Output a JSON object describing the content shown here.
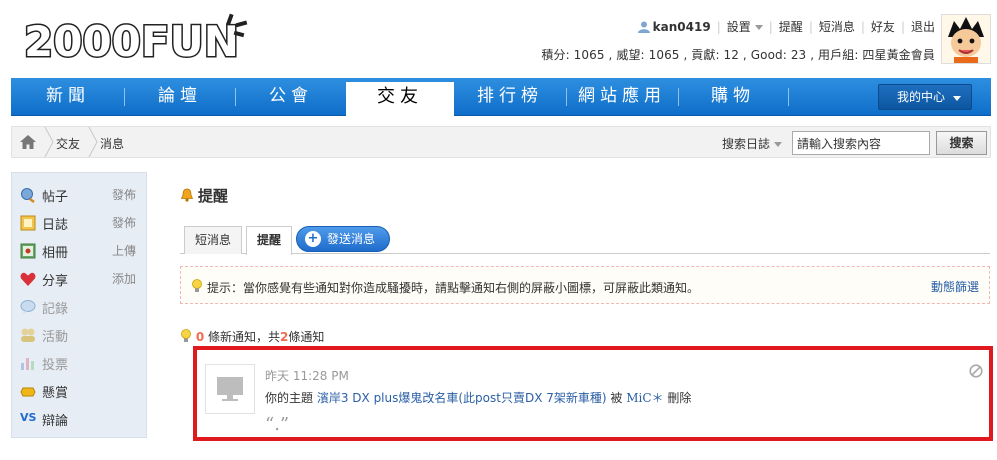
{
  "header": {
    "logo_text": "2000FUN",
    "username": "kan0419",
    "menu": [
      "設置",
      "提醒",
      "短消息",
      "好友",
      "退出"
    ],
    "stats": "積分: 1065 , 威望: 1065 , 貢獻: 12 , Good: 23 , 用戶組: 四星黃金會員"
  },
  "nav": {
    "items": [
      "新聞",
      "論壇",
      "公會",
      "交友",
      "排行榜",
      "網站應用",
      "購物"
    ],
    "my_center": "我的中心"
  },
  "breadcrumb": {
    "items": [
      "交友",
      "消息"
    ],
    "search_label": "搜索日誌",
    "search_placeholder": "請輸入搜索內容",
    "search_button": "搜索"
  },
  "sidebar": {
    "items": [
      {
        "label": "帖子",
        "action": "發佈",
        "icon": "post-icon"
      },
      {
        "label": "日誌",
        "action": "發佈",
        "icon": "blog-icon"
      },
      {
        "label": "相冊",
        "action": "上傳",
        "icon": "album-icon"
      },
      {
        "label": "分享",
        "action": "添加",
        "icon": "share-icon"
      },
      {
        "label": "記錄",
        "action": "",
        "icon": "record-icon"
      },
      {
        "label": "活動",
        "action": "",
        "icon": "activity-icon"
      },
      {
        "label": "投票",
        "action": "",
        "icon": "poll-icon"
      },
      {
        "label": "懸賞",
        "action": "",
        "icon": "reward-icon"
      },
      {
        "label": "辯論",
        "action": "",
        "icon": "debate-icon",
        "prefix": "VS"
      }
    ]
  },
  "main": {
    "title": "提醒",
    "tabs": [
      "短消息",
      "提醒"
    ],
    "compose": "發送消息",
    "tip": "提示：當你感覺有些通知對你造成騷擾時，請點擊通知右側的屏蔽小圖標，可屏蔽此類通知。",
    "tip_link": "動態篩選",
    "count_new": "0",
    "count_new_label": "條新通知，共",
    "count_total": "2",
    "count_total_label": "條通知",
    "notice": {
      "time": "昨天 11:28 PM",
      "prefix": "你的主題",
      "topic": "濱岸3 DX plus爆鬼改名車(此post只賣DX 7架新車種)",
      "by_label": "被",
      "by_user": "MiC＊",
      "action": "刪除",
      "quote": "“.”"
    }
  }
}
